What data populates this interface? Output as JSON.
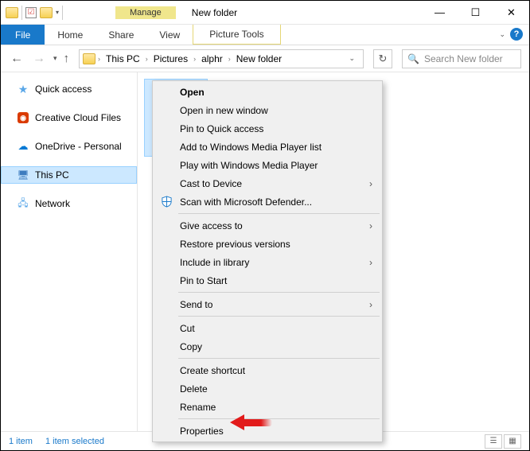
{
  "titlebar": {
    "contextual_tab": "Manage",
    "title": "New folder"
  },
  "win_controls": {
    "min": "—",
    "max": "☐",
    "close": "✕"
  },
  "ribbon": {
    "file": "File",
    "tabs": [
      "Home",
      "Share",
      "View"
    ],
    "contextual": "Picture Tools"
  },
  "breadcrumb": [
    "This PC",
    "Pictures",
    "alphr",
    "New folder"
  ],
  "search": {
    "placeholder": "Search New folder"
  },
  "nav_pane": [
    {
      "label": "Quick access",
      "icon": "star"
    },
    {
      "label": "Creative Cloud Files",
      "icon": "cc"
    },
    {
      "label": "OneDrive - Personal",
      "icon": "cloud"
    },
    {
      "label": "This PC",
      "icon": "pc",
      "selected": true
    },
    {
      "label": "Network",
      "icon": "net"
    }
  ],
  "context_menu": {
    "open": "Open",
    "open_new_window": "Open in new window",
    "pin_quick_access": "Pin to Quick access",
    "add_wmp_list": "Add to Windows Media Player list",
    "play_wmp": "Play with Windows Media Player",
    "cast": "Cast to Device",
    "scan_defender": "Scan with Microsoft Defender...",
    "give_access": "Give access to",
    "restore_prev": "Restore previous versions",
    "include_library": "Include in library",
    "pin_start": "Pin to Start",
    "send_to": "Send to",
    "cut": "Cut",
    "copy": "Copy",
    "create_shortcut": "Create shortcut",
    "delete": "Delete",
    "rename": "Rename",
    "properties": "Properties"
  },
  "status": {
    "count": "1 item",
    "selected": "1 item selected"
  }
}
